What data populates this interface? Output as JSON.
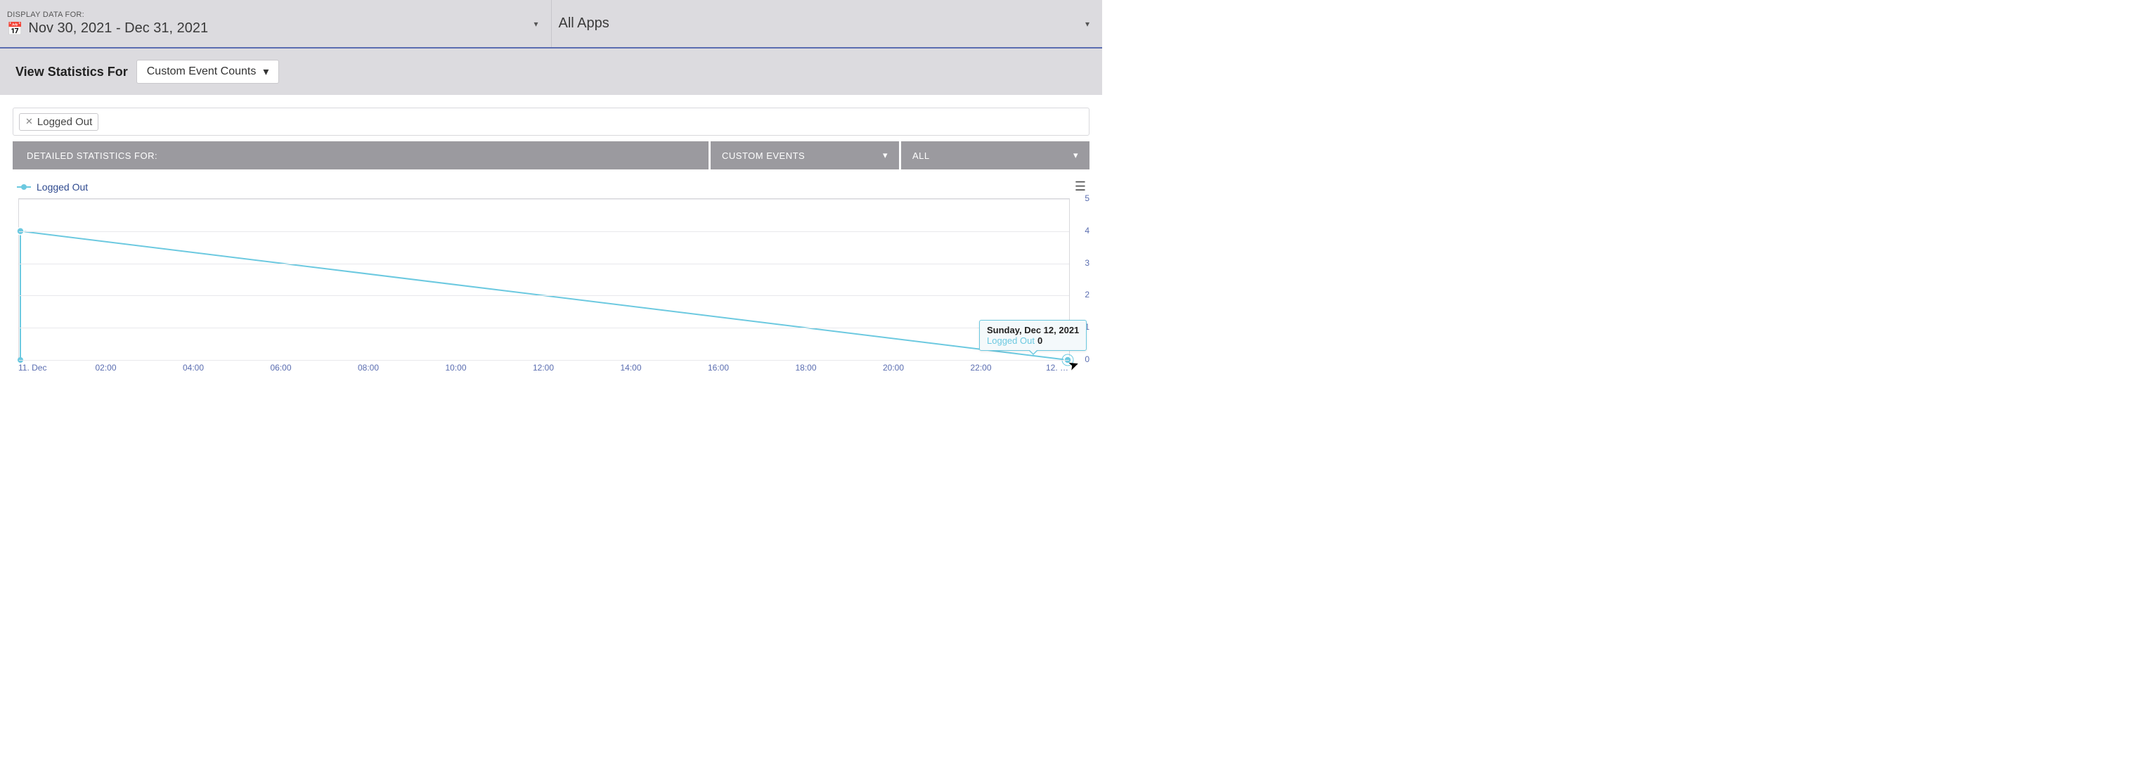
{
  "header": {
    "display_label": "DISPLAY DATA FOR:",
    "date_range": "Nov 30, 2021 - Dec 31, 2021",
    "app_filter": "All Apps"
  },
  "subheader": {
    "label": "View Statistics For",
    "select_value": "Custom Event Counts"
  },
  "tags": [
    {
      "label": "Logged Out"
    }
  ],
  "stats_bar": {
    "label": "DETAILED STATISTICS FOR:",
    "dropdown1": "CUSTOM EVENTS",
    "dropdown2": "ALL"
  },
  "legend": {
    "series_name": "Logged Out"
  },
  "tooltip": {
    "title": "Sunday, Dec 12, 2021",
    "series": "Logged Out",
    "value": "0"
  },
  "chart_data": {
    "type": "line",
    "title": "",
    "xlabel": "",
    "ylabel": "",
    "ylim": [
      0,
      5
    ],
    "y_ticks": [
      0,
      1,
      2,
      3,
      4,
      5
    ],
    "x_ticks": [
      "11. Dec",
      "02:00",
      "04:00",
      "06:00",
      "08:00",
      "10:00",
      "12:00",
      "14:00",
      "16:00",
      "18:00",
      "20:00",
      "22:00",
      "12. …"
    ],
    "series": [
      {
        "name": "Logged Out",
        "color": "#6cc9e0",
        "x": [
          "11. Dec 00:00",
          "12. Dec 00:00"
        ],
        "values": [
          4,
          0
        ]
      }
    ],
    "highlight_point": {
      "x_index": 1,
      "value": 0
    }
  }
}
